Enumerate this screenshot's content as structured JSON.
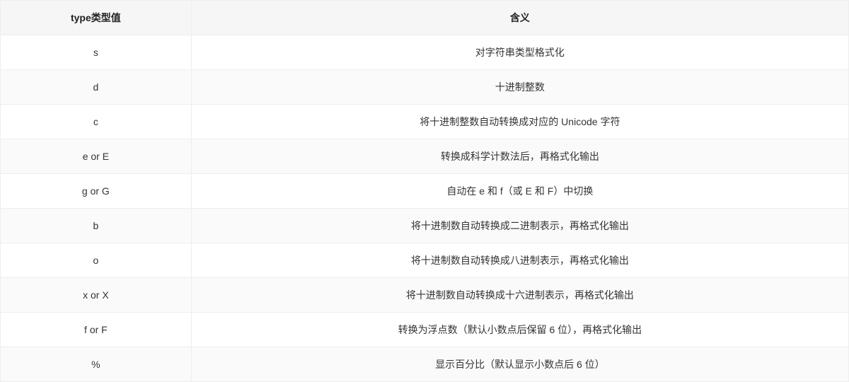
{
  "table": {
    "headers": [
      "type类型值",
      "含义"
    ],
    "rows": [
      {
        "type": "s",
        "meaning": "对字符串类型格式化"
      },
      {
        "type": "d",
        "meaning": "十进制整数"
      },
      {
        "type": "c",
        "meaning": "将十进制整数自动转换成对应的 Unicode 字符"
      },
      {
        "type": "e or E",
        "meaning": "转换成科学计数法后，再格式化输出"
      },
      {
        "type": "g or G",
        "meaning": "自动在 e 和 f（或 E 和 F）中切换"
      },
      {
        "type": "b",
        "meaning": "将十进制数自动转换成二进制表示，再格式化输出"
      },
      {
        "type": "o",
        "meaning": "将十进制数自动转换成八进制表示，再格式化输出"
      },
      {
        "type": "x or X",
        "meaning": "将十进制数自动转换成十六进制表示，再格式化输出"
      },
      {
        "type": "f or F",
        "meaning": "转换为浮点数（默认小数点后保留 6 位），再格式化输出"
      },
      {
        "type": "%",
        "meaning": "显示百分比（默认显示小数点后 6 位）"
      }
    ]
  }
}
